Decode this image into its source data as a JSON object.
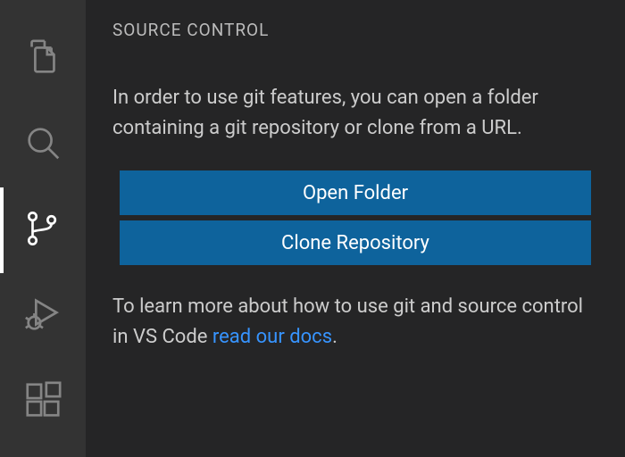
{
  "activityBar": {
    "items": [
      {
        "name": "explorer",
        "active": false
      },
      {
        "name": "search",
        "active": false
      },
      {
        "name": "source-control",
        "active": true
      },
      {
        "name": "run-debug",
        "active": false
      },
      {
        "name": "extensions",
        "active": false
      }
    ]
  },
  "panel": {
    "title": "SOURCE CONTROL",
    "intro_text": "In order to use git features, you can open a folder containing a git repository or clone from a URL.",
    "open_folder_label": "Open Folder",
    "clone_repo_label": "Clone Repository",
    "docs_prefix": "To learn more about how to use git and source control in VS Code ",
    "docs_link": "read our docs",
    "docs_suffix": "."
  },
  "colors": {
    "accent": "#0e639c",
    "link": "#3794ff",
    "panel_bg": "#252526",
    "bar_bg": "#333333"
  }
}
